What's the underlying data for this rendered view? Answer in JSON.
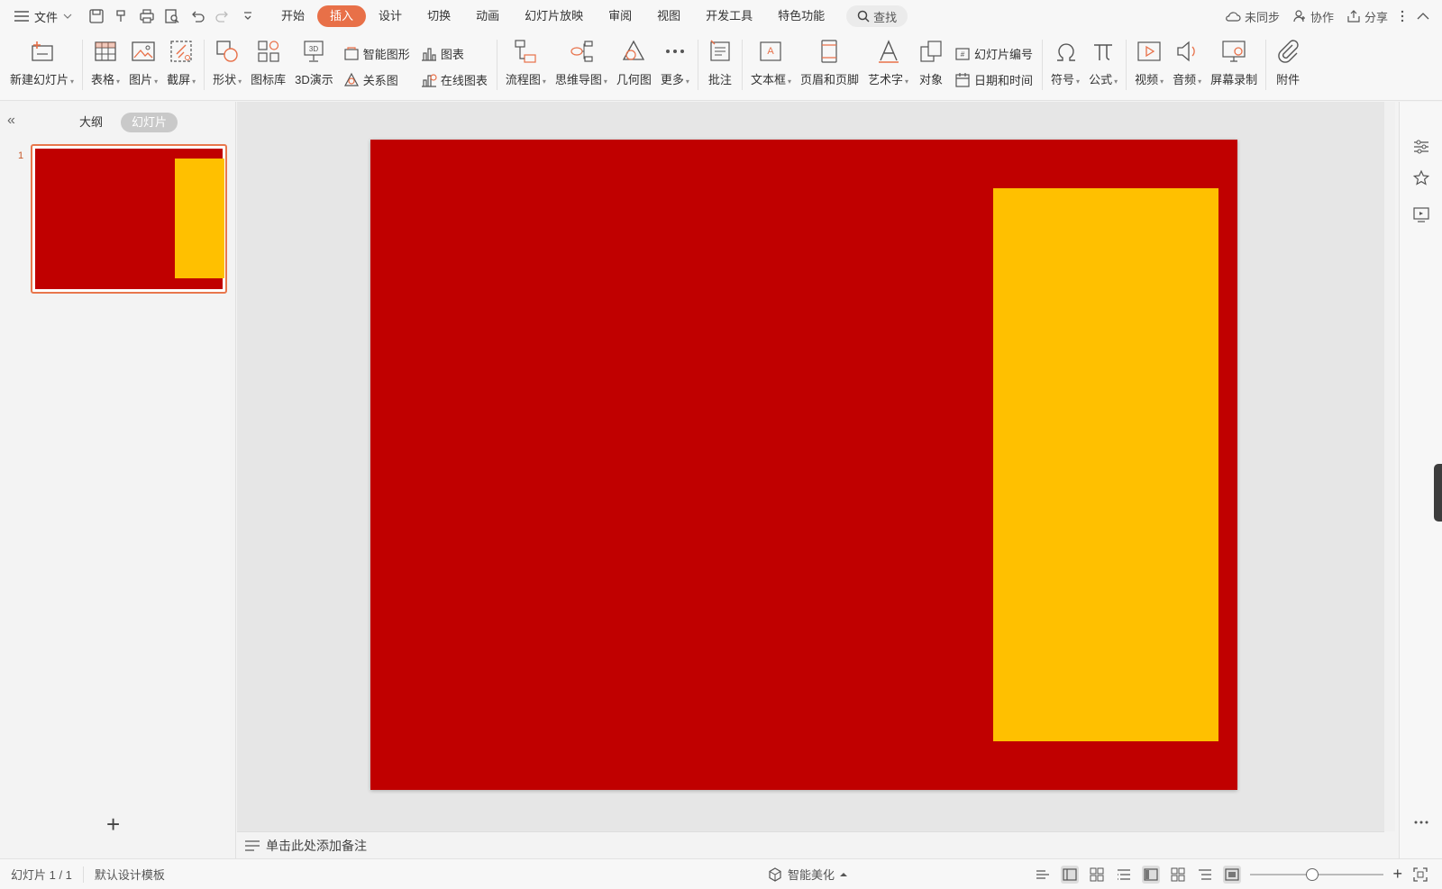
{
  "menubar": {
    "file_label": "文件",
    "tabs": [
      "开始",
      "插入",
      "设计",
      "切换",
      "动画",
      "幻灯片放映",
      "审阅",
      "视图",
      "开发工具",
      "特色功能"
    ],
    "active_tab": "插入",
    "search_label": "查找",
    "sync_label": "未同步",
    "collab_label": "协作",
    "share_label": "分享"
  },
  "ribbon": {
    "new_slide": "新建幻灯片",
    "table": "表格",
    "picture": "图片",
    "screenshot": "截屏",
    "shape": "形状",
    "icon_lib": "图标库",
    "demo3d": "3D演示",
    "smart_shape": "智能图形",
    "chart": "图表",
    "relation": "关系图",
    "online_chart": "在线图表",
    "flowchart": "流程图",
    "mindmap": "思维导图",
    "geometry": "几何图",
    "more": "更多",
    "comment": "批注",
    "textbox": "文本框",
    "header_footer": "页眉和页脚",
    "wordart": "艺术字",
    "object": "对象",
    "slide_number": "幻灯片编号",
    "datetime": "日期和时间",
    "symbol": "符号",
    "formula": "公式",
    "video": "视频",
    "audio": "音频",
    "screen_record": "屏幕录制",
    "attachment": "附件"
  },
  "left_panel": {
    "outline_tab": "大纲",
    "slides_tab": "幻灯片",
    "slide_number": "1"
  },
  "slide": {
    "background_color": "#C00000",
    "rect_color": "#FFC000"
  },
  "notes": {
    "placeholder": "单击此处添加备注"
  },
  "status": {
    "slide_counter": "幻灯片 1 / 1",
    "template": "默认设计模板",
    "beautify": "智能美化"
  },
  "colors": {
    "accent": "#E87048"
  }
}
